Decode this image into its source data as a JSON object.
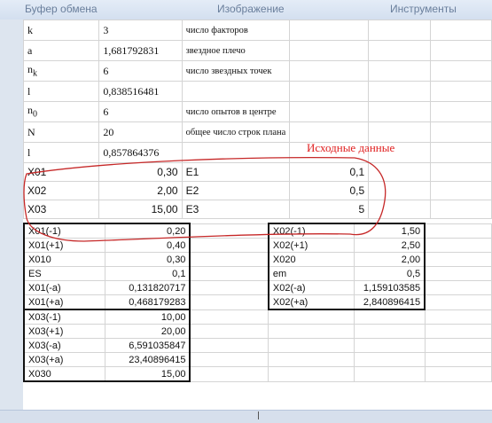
{
  "ribbon": {
    "groups": [
      "Буфер обмена",
      "Изображение",
      "Инструменты"
    ]
  },
  "annotation": "Исходные данные",
  "params": [
    {
      "name": "k",
      "value": "3",
      "desc": "число факторов"
    },
    {
      "name": "a",
      "value": "1,681792831",
      "desc": "звездное плечо"
    },
    {
      "name": "nk",
      "name_sub": "k",
      "value": "6",
      "desc": "число звездных точек"
    },
    {
      "name": "l",
      "value": "0,838516481",
      "desc": ""
    },
    {
      "name": "n0",
      "name_sub": "0",
      "value": "6",
      "desc": "число опытов в центре"
    },
    {
      "name": "N",
      "value": "20",
      "desc": "общее число строк плана"
    },
    {
      "name": "l",
      "value": "0,857864376",
      "desc": ""
    }
  ],
  "inputs": [
    {
      "x": "X01",
      "x_val": "0,30",
      "e": "E1",
      "e_val": "0,1"
    },
    {
      "x": "X02",
      "x_val": "2,00",
      "e": "E2",
      "e_val": "0,5"
    },
    {
      "x": "X03",
      "x_val": "15,00",
      "e": "E3",
      "e_val": "5"
    }
  ],
  "left_block": [
    {
      "label": "X01(-1)",
      "value": "0,20"
    },
    {
      "label": "X01(+1)",
      "value": "0,40"
    },
    {
      "label": "X010",
      "value": "0,30"
    },
    {
      "label": "ES",
      "value": "0,1"
    },
    {
      "label": "X01(-a)",
      "value": "0,131820717"
    },
    {
      "label": "X01(+a)",
      "value": "0,468179283"
    },
    {
      "label": "X03(-1)",
      "value": "10,00"
    },
    {
      "label": "X03(+1)",
      "value": "20,00"
    },
    {
      "label": "X03(-a)",
      "value": "6,591035847"
    },
    {
      "label": "X03(+a)",
      "value": "23,40896415"
    },
    {
      "label": "X030",
      "value": "15,00"
    }
  ],
  "right_block": [
    {
      "label": "X02(-1)",
      "value": "1,50"
    },
    {
      "label": "X02(+1)",
      "value": "2,50"
    },
    {
      "label": "X020",
      "value": "2,00"
    },
    {
      "label": "em",
      "value": "0,5"
    },
    {
      "label": "X02(-a)",
      "value": "1,159103585"
    },
    {
      "label": "X02(+a)",
      "value": "2,840896415"
    }
  ],
  "colors": {
    "annotation": "#e02020",
    "loop": "#c62828",
    "grid": "#d4d4d4",
    "header_bg": "#dde5ef"
  }
}
